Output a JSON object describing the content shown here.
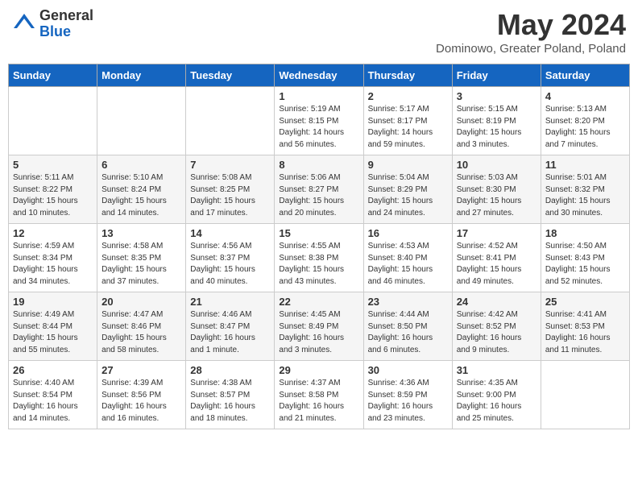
{
  "header": {
    "logo_line1": "General",
    "logo_line2": "Blue",
    "month_title": "May 2024",
    "location": "Dominowo, Greater Poland, Poland"
  },
  "days_of_week": [
    "Sunday",
    "Monday",
    "Tuesday",
    "Wednesday",
    "Thursday",
    "Friday",
    "Saturday"
  ],
  "weeks": [
    [
      {
        "day": "",
        "info": ""
      },
      {
        "day": "",
        "info": ""
      },
      {
        "day": "",
        "info": ""
      },
      {
        "day": "1",
        "info": "Sunrise: 5:19 AM\nSunset: 8:15 PM\nDaylight: 14 hours\nand 56 minutes."
      },
      {
        "day": "2",
        "info": "Sunrise: 5:17 AM\nSunset: 8:17 PM\nDaylight: 14 hours\nand 59 minutes."
      },
      {
        "day": "3",
        "info": "Sunrise: 5:15 AM\nSunset: 8:19 PM\nDaylight: 15 hours\nand 3 minutes."
      },
      {
        "day": "4",
        "info": "Sunrise: 5:13 AM\nSunset: 8:20 PM\nDaylight: 15 hours\nand 7 minutes."
      }
    ],
    [
      {
        "day": "5",
        "info": "Sunrise: 5:11 AM\nSunset: 8:22 PM\nDaylight: 15 hours\nand 10 minutes."
      },
      {
        "day": "6",
        "info": "Sunrise: 5:10 AM\nSunset: 8:24 PM\nDaylight: 15 hours\nand 14 minutes."
      },
      {
        "day": "7",
        "info": "Sunrise: 5:08 AM\nSunset: 8:25 PM\nDaylight: 15 hours\nand 17 minutes."
      },
      {
        "day": "8",
        "info": "Sunrise: 5:06 AM\nSunset: 8:27 PM\nDaylight: 15 hours\nand 20 minutes."
      },
      {
        "day": "9",
        "info": "Sunrise: 5:04 AM\nSunset: 8:29 PM\nDaylight: 15 hours\nand 24 minutes."
      },
      {
        "day": "10",
        "info": "Sunrise: 5:03 AM\nSunset: 8:30 PM\nDaylight: 15 hours\nand 27 minutes."
      },
      {
        "day": "11",
        "info": "Sunrise: 5:01 AM\nSunset: 8:32 PM\nDaylight: 15 hours\nand 30 minutes."
      }
    ],
    [
      {
        "day": "12",
        "info": "Sunrise: 4:59 AM\nSunset: 8:34 PM\nDaylight: 15 hours\nand 34 minutes."
      },
      {
        "day": "13",
        "info": "Sunrise: 4:58 AM\nSunset: 8:35 PM\nDaylight: 15 hours\nand 37 minutes."
      },
      {
        "day": "14",
        "info": "Sunrise: 4:56 AM\nSunset: 8:37 PM\nDaylight: 15 hours\nand 40 minutes."
      },
      {
        "day": "15",
        "info": "Sunrise: 4:55 AM\nSunset: 8:38 PM\nDaylight: 15 hours\nand 43 minutes."
      },
      {
        "day": "16",
        "info": "Sunrise: 4:53 AM\nSunset: 8:40 PM\nDaylight: 15 hours\nand 46 minutes."
      },
      {
        "day": "17",
        "info": "Sunrise: 4:52 AM\nSunset: 8:41 PM\nDaylight: 15 hours\nand 49 minutes."
      },
      {
        "day": "18",
        "info": "Sunrise: 4:50 AM\nSunset: 8:43 PM\nDaylight: 15 hours\nand 52 minutes."
      }
    ],
    [
      {
        "day": "19",
        "info": "Sunrise: 4:49 AM\nSunset: 8:44 PM\nDaylight: 15 hours\nand 55 minutes."
      },
      {
        "day": "20",
        "info": "Sunrise: 4:47 AM\nSunset: 8:46 PM\nDaylight: 15 hours\nand 58 minutes."
      },
      {
        "day": "21",
        "info": "Sunrise: 4:46 AM\nSunset: 8:47 PM\nDaylight: 16 hours\nand 1 minute."
      },
      {
        "day": "22",
        "info": "Sunrise: 4:45 AM\nSunset: 8:49 PM\nDaylight: 16 hours\nand 3 minutes."
      },
      {
        "day": "23",
        "info": "Sunrise: 4:44 AM\nSunset: 8:50 PM\nDaylight: 16 hours\nand 6 minutes."
      },
      {
        "day": "24",
        "info": "Sunrise: 4:42 AM\nSunset: 8:52 PM\nDaylight: 16 hours\nand 9 minutes."
      },
      {
        "day": "25",
        "info": "Sunrise: 4:41 AM\nSunset: 8:53 PM\nDaylight: 16 hours\nand 11 minutes."
      }
    ],
    [
      {
        "day": "26",
        "info": "Sunrise: 4:40 AM\nSunset: 8:54 PM\nDaylight: 16 hours\nand 14 minutes."
      },
      {
        "day": "27",
        "info": "Sunrise: 4:39 AM\nSunset: 8:56 PM\nDaylight: 16 hours\nand 16 minutes."
      },
      {
        "day": "28",
        "info": "Sunrise: 4:38 AM\nSunset: 8:57 PM\nDaylight: 16 hours\nand 18 minutes."
      },
      {
        "day": "29",
        "info": "Sunrise: 4:37 AM\nSunset: 8:58 PM\nDaylight: 16 hours\nand 21 minutes."
      },
      {
        "day": "30",
        "info": "Sunrise: 4:36 AM\nSunset: 8:59 PM\nDaylight: 16 hours\nand 23 minutes."
      },
      {
        "day": "31",
        "info": "Sunrise: 4:35 AM\nSunset: 9:00 PM\nDaylight: 16 hours\nand 25 minutes."
      },
      {
        "day": "",
        "info": ""
      }
    ]
  ]
}
